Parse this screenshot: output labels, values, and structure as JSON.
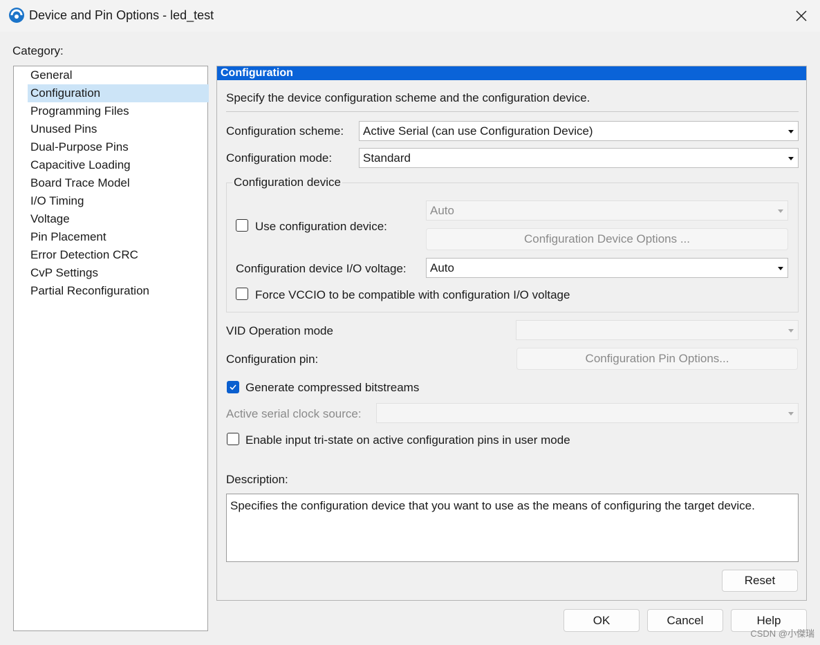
{
  "window": {
    "title": "Device and Pin Options - led_test"
  },
  "category": {
    "label": "Category:",
    "items": [
      {
        "label": "General",
        "selected": false
      },
      {
        "label": "Configuration",
        "selected": true
      },
      {
        "label": "Programming Files",
        "selected": false
      },
      {
        "label": "Unused Pins",
        "selected": false
      },
      {
        "label": "Dual-Purpose Pins",
        "selected": false
      },
      {
        "label": "Capacitive Loading",
        "selected": false
      },
      {
        "label": "Board Trace Model",
        "selected": false
      },
      {
        "label": "I/O Timing",
        "selected": false
      },
      {
        "label": "Voltage",
        "selected": false
      },
      {
        "label": "Pin Placement",
        "selected": false
      },
      {
        "label": "Error Detection CRC",
        "selected": false
      },
      {
        "label": "CvP Settings",
        "selected": false
      },
      {
        "label": "Partial Reconfiguration",
        "selected": false
      }
    ]
  },
  "panel": {
    "header": "Configuration",
    "intro": "Specify the device configuration scheme and the configuration device.",
    "scheme_label": "Configuration scheme:",
    "scheme_value": "Active Serial (can use Configuration Device)",
    "mode_label": "Configuration mode:",
    "mode_value": "Standard",
    "group_title": "Configuration device",
    "use_device_label": "Use configuration device:",
    "use_device_checked": false,
    "device_combo_value": "Auto",
    "device_options_button": "Configuration Device Options ...",
    "io_voltage_label": "Configuration device I/O voltage:",
    "io_voltage_value": "Auto",
    "force_vccio_label": "Force VCCIO to be compatible with configuration I/O voltage",
    "force_vccio_checked": false,
    "vid_label": "VID Operation mode",
    "vid_value": "",
    "pin_label": "Configuration pin:",
    "pin_button": "Configuration Pin Options...",
    "compressed_label": "Generate compressed bitstreams",
    "compressed_checked": true,
    "clock_label": "Active serial clock source:",
    "clock_value": "",
    "tristate_label": "Enable input tri-state on active configuration pins in user mode",
    "tristate_checked": false,
    "description_label": "Description:",
    "description_text": "Specifies the configuration device that you want to use as the means of configuring the target device.",
    "reset_button": "Reset"
  },
  "footer": {
    "ok": "OK",
    "cancel": "Cancel",
    "help": "Help"
  },
  "watermark": "CSDN @小傑瑞",
  "colors": {
    "accent": "#0a63d8",
    "selection": "#cce4f7"
  }
}
